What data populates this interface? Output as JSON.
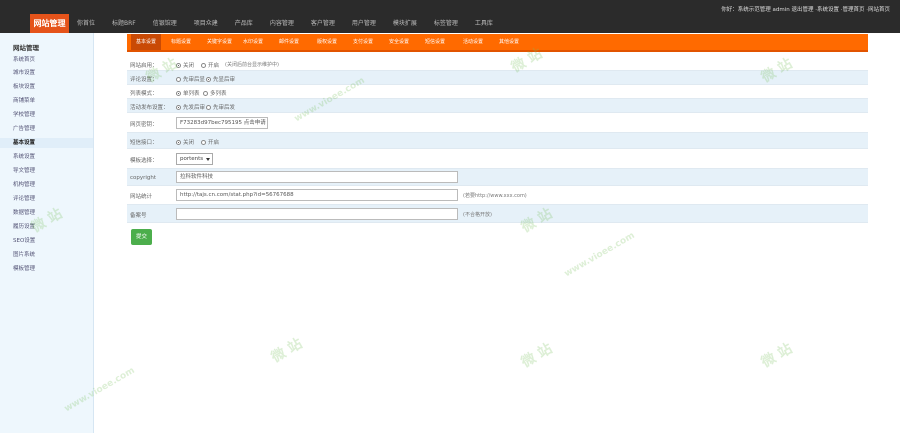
{
  "header": {
    "brand": "网站管理",
    "nav": [
      "你首位",
      "标题BRF",
      "信银馆理",
      "项目众建",
      "产品库",
      "内容管理",
      "客户管理",
      "用户管理",
      "模块扩展",
      "标签管理",
      "工具库"
    ],
    "user_info": "你好：系统示范管理 admin 退出管理 ·系统设置 ·管理首页 ·网站首页"
  },
  "sidebar": {
    "title": "网站管理",
    "items": [
      "系统首页",
      "城市设置",
      "板块设置",
      "商铺菜单",
      "学校管理",
      "广告管理",
      "基本设置",
      "系统设置",
      "导文管理",
      "机构管理",
      "评论管理",
      "数据管理",
      "履历设置",
      "SEO设置",
      "图片系统",
      "模板管理"
    ],
    "active_index": 6
  },
  "tabs": {
    "items": [
      "基本设置",
      "标题设置",
      "关键字设置",
      "水印设置",
      "邮件设置",
      "版权设置",
      "支付设置",
      "安全设置",
      "短信设置",
      "活动设置",
      "其他设置"
    ],
    "active_index": 0
  },
  "form": {
    "site_status": {
      "label": "网站启用：",
      "on": "关闭",
      "off": "开启",
      "note": "(关闭后前台显示维护中)",
      "selected": 0
    },
    "comment_audit": {
      "label": "评论设置：",
      "a": "先审后显",
      "b": "先显后审",
      "selected": 1
    },
    "list_mode": {
      "label": "列表模式：",
      "a": "单列表",
      "b": "多列表",
      "selected": 0
    },
    "activity_audit": {
      "label": "活动发布设置：",
      "a": "先发后审",
      "b": "先审后发",
      "selected": 0
    },
    "site_key": {
      "label": "网页密钥：",
      "value": "F73283d97bec795195 点击申请"
    },
    "sms": {
      "label": "短信接口：",
      "a": "关闭",
      "b": "开启",
      "selected": 0
    },
    "template": {
      "label": "模板选择：",
      "value": "portents"
    },
    "copyright": {
      "label": "copyright",
      "value": "拉科软件科技"
    },
    "stat_code": {
      "label": "网站统计",
      "value": "http://tajs.cn.com/stat.php?id=56767688",
      "hint": "(若要http://www.xxx.com)"
    },
    "beian": {
      "label": "备案号",
      "value": "",
      "hint": "(不合格开放)"
    },
    "submit_label": "提交"
  },
  "watermark": {
    "text": "微 站",
    "url": "www.vioee.com"
  }
}
